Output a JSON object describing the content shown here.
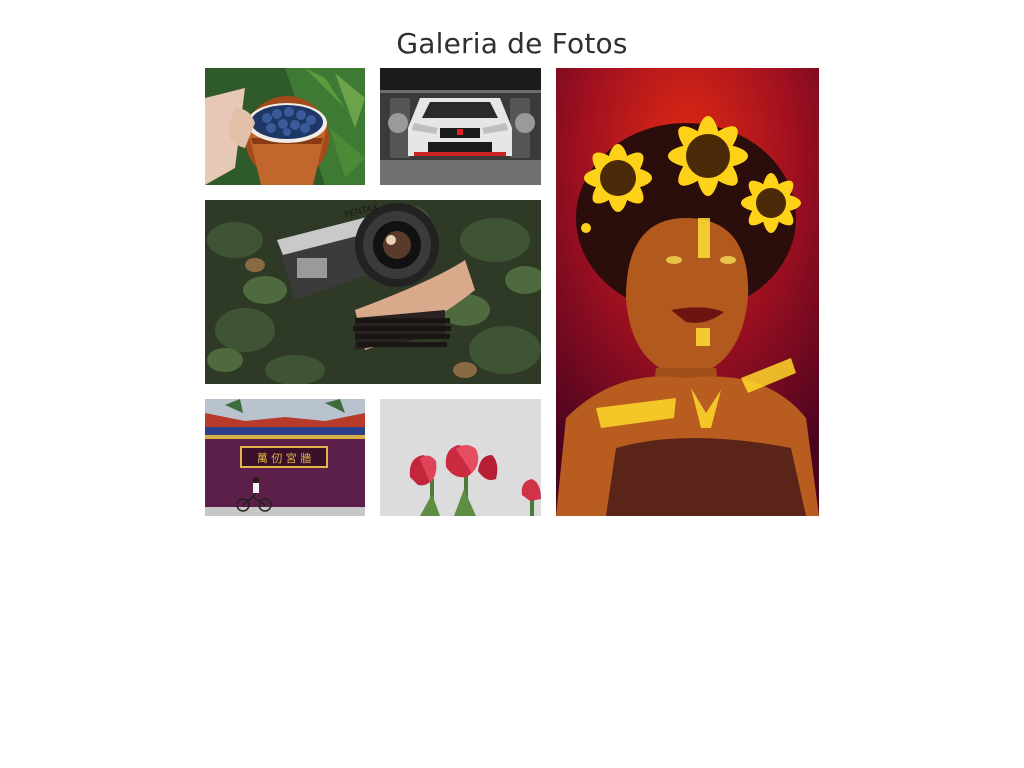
{
  "gallery": {
    "title": "Galeria de Fotos",
    "photos": [
      {
        "subject": "blueberries-cup",
        "sign_text": ""
      },
      {
        "subject": "white-sports-car",
        "sign_text": ""
      },
      {
        "subject": "hand-holding-camera",
        "sign_text": "PENTAX"
      },
      {
        "subject": "temple-cyclist",
        "sign_text": "萬 仞 宮 牆"
      },
      {
        "subject": "red-tulips",
        "sign_text": ""
      },
      {
        "subject": "woman-sunflower-crown",
        "sign_text": ""
      }
    ]
  }
}
